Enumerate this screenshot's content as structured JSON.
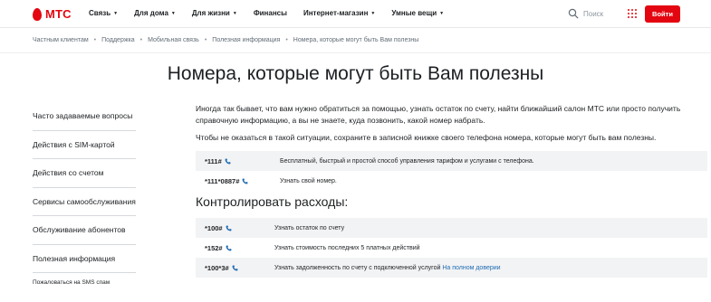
{
  "header": {
    "logo_text": "МТС",
    "nav": [
      "Связь",
      "Для дома",
      "Для жизни",
      "Финансы",
      "Интернет-магазин",
      "Умные вещи"
    ],
    "nav_with_caret": [
      true,
      true,
      true,
      false,
      true,
      true
    ],
    "search_label": "Поиск",
    "login_label": "Войти"
  },
  "breadcrumbs": [
    "Частным клиентам",
    "Поддержка",
    "Мобильная связь",
    "Полезная информация",
    "Номера, которые могут быть Вам полезны"
  ],
  "page_title": "Номера, которые могут быть Вам полезны",
  "sidebar": {
    "items": [
      "Часто задаваемые вопросы",
      "Действия с SIM-картой",
      "Действия со счетом",
      "Сервисы самообслуживания",
      "Обслуживание абонентов",
      "Полезная информация"
    ],
    "sub_item": "Пожаловаться на SMS спам"
  },
  "main": {
    "paragraphs": [
      "Иногда так бывает, что вам нужно обратиться за помощью, узнать остаток по счету, найти ближайший салон МТС или просто получить справочную информацию, а вы не знаете, куда позвонить, какой номер набрать.",
      "Чтобы не оказаться в такой ситуации, сохраните в записной книжке своего телефона номера, которые могут быть вам полезны."
    ],
    "table1": [
      {
        "number": "*111#",
        "desc": "Бесплатный, быстрый и простой способ управления тарифом и услугами с телефона."
      },
      {
        "number": "*111*0887#",
        "desc": "Узнать свой номер."
      }
    ],
    "section_title": "Контролировать расходы:",
    "table2": [
      {
        "number": "*100#",
        "desc": "Узнать остаток по счету",
        "link": ""
      },
      {
        "number": "*152#",
        "desc": "Узнать стоимость последних 5 платных действий",
        "link": ""
      },
      {
        "number": "*100*3#",
        "desc": "Узнать задолженность по счету с подключенной услугой",
        "link": "На полном доверии"
      }
    ]
  },
  "colors": {
    "brand": "#e30611",
    "link": "#1f6db3",
    "row_shade": "#f2f3f5"
  }
}
